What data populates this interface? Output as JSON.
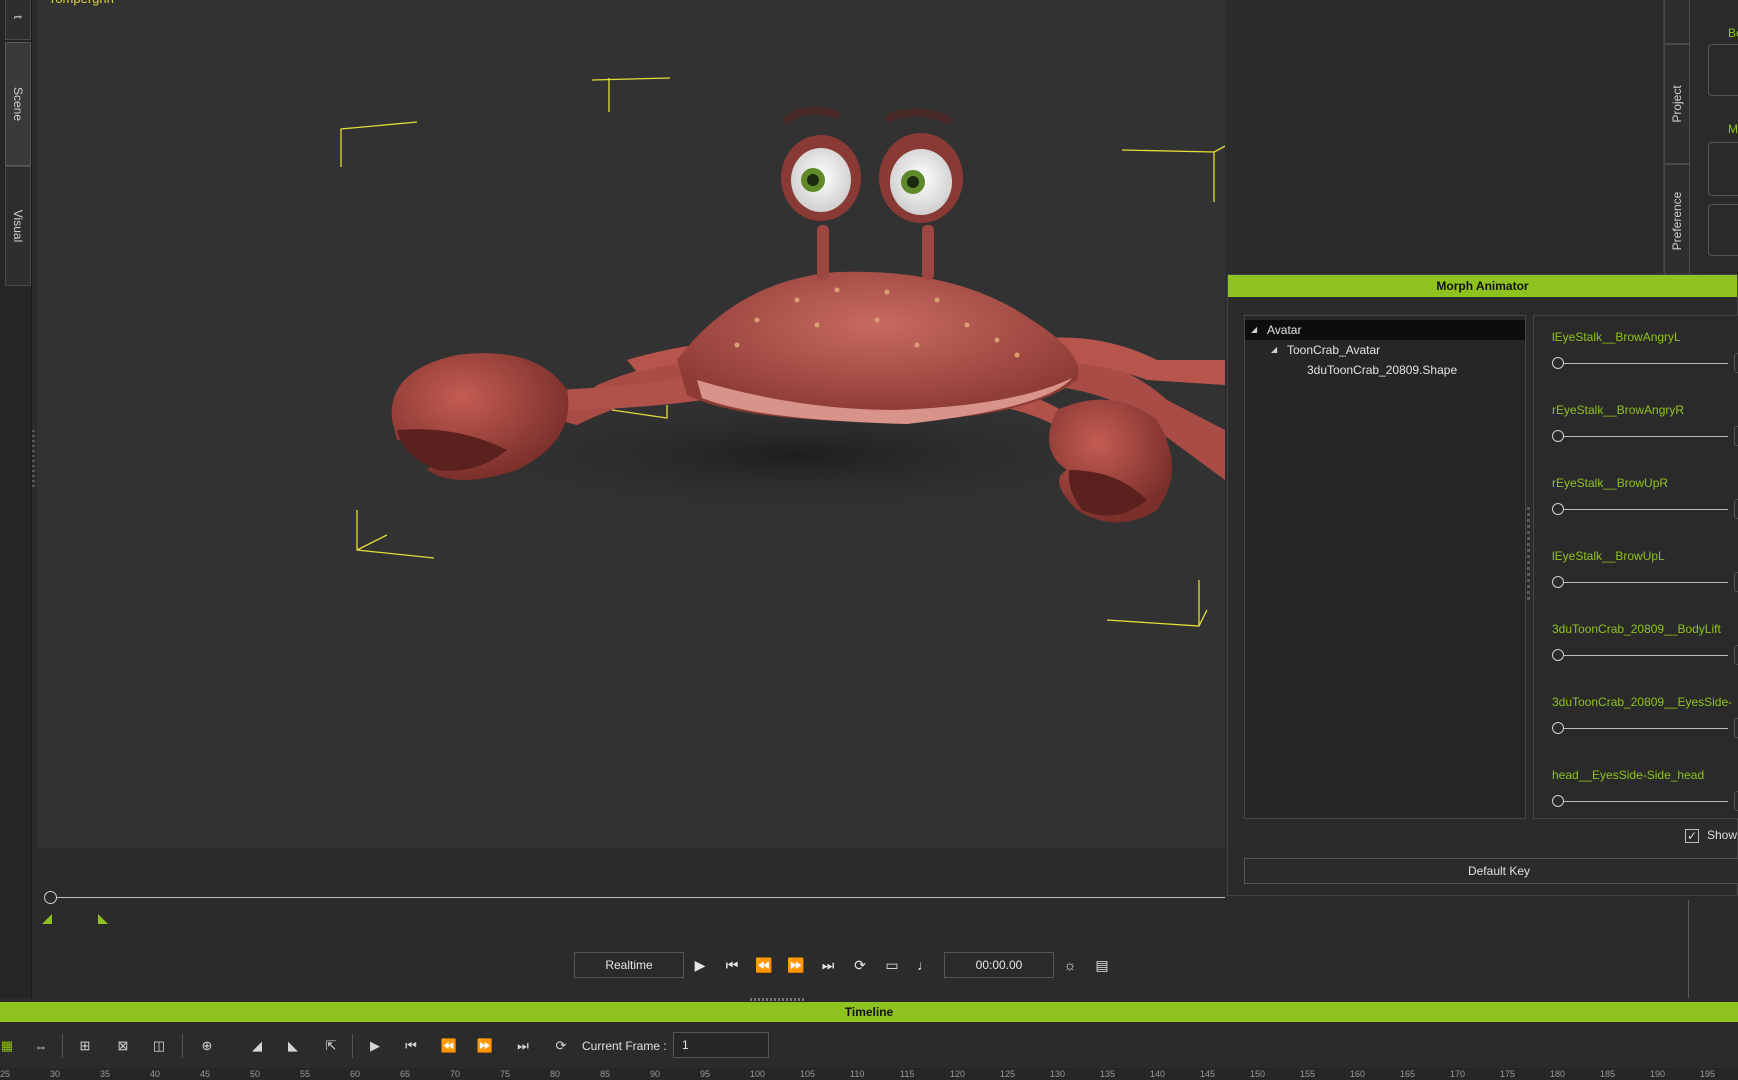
{
  "viewport": {
    "label": "rompergnn"
  },
  "left_tabs": [
    {
      "label": "t"
    },
    {
      "label": "Scene"
    },
    {
      "label": "Visual"
    }
  ],
  "right_tabs": [
    {
      "label": "Project"
    },
    {
      "label": "Preference"
    }
  ],
  "right_panel": {
    "labels": [
      "Be",
      "M"
    ]
  },
  "morph_animator": {
    "title": "Morph Animator",
    "tree": [
      {
        "label": "Avatar",
        "level": 0,
        "expanded": true,
        "selected": true
      },
      {
        "label": "ToonCrab_Avatar",
        "level": 1,
        "expanded": true,
        "selected": false
      },
      {
        "label": "3duToonCrab_20809.Shape",
        "level": 2,
        "expanded": false,
        "selected": false
      }
    ],
    "morphs": [
      {
        "name": "lEyeStalk__BrowAngryL",
        "value": 0
      },
      {
        "name": "rEyeStalk__BrowAngryR",
        "value": 0
      },
      {
        "name": "rEyeStalk__BrowUpR",
        "value": 0
      },
      {
        "name": "lEyeStalk__BrowUpL",
        "value": 0
      },
      {
        "name": "3duToonCrab_20809__BodyLift",
        "value": 0
      },
      {
        "name": "3duToonCrab_20809__EyesSide-",
        "value": 0
      },
      {
        "name": "head__EyesSide-Side_head",
        "value": 0
      }
    ],
    "show_label": "Show",
    "show_checked": true,
    "default_key_label": "Default Key"
  },
  "playback": {
    "mode": "Realtime",
    "time": "00:00.00",
    "time_slider_position": 0
  },
  "timeline": {
    "title": "Timeline",
    "current_frame_label": "Current Frame :",
    "current_frame_value": "1",
    "ruler_ticks": [
      "25",
      "30",
      "35",
      "40",
      "45",
      "50",
      "55",
      "60",
      "65",
      "70",
      "75",
      "80",
      "85",
      "90",
      "95",
      "100",
      "105",
      "110",
      "115",
      "120",
      "125",
      "130",
      "135",
      "140",
      "145",
      "150",
      "155",
      "160",
      "165",
      "170",
      "175",
      "180",
      "185",
      "190",
      "195"
    ]
  },
  "colors": {
    "accent": "#8ec21f",
    "background": "#2b2b2b",
    "viewport": "#323232",
    "gizmo": "#e6dc38",
    "crab_shell": "#b4524a"
  }
}
